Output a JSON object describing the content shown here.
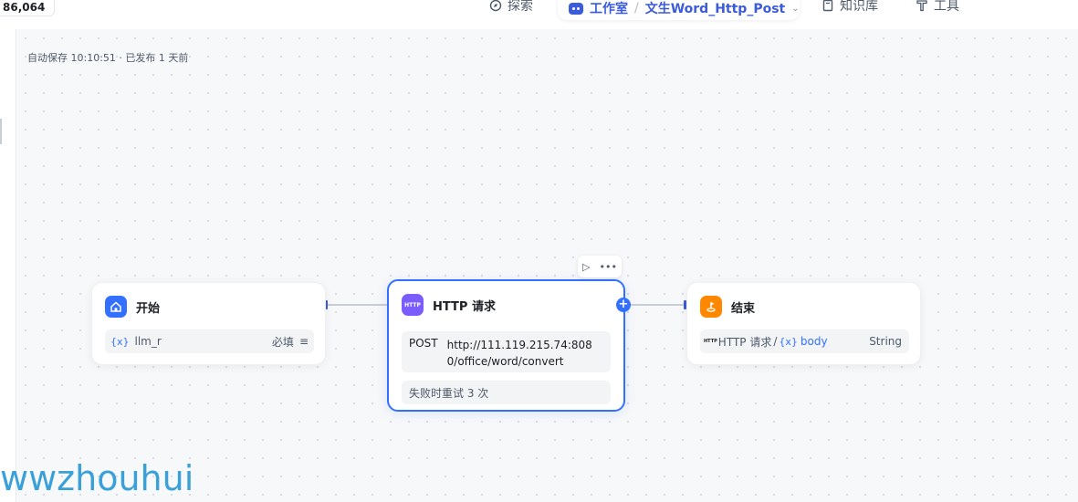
{
  "top_counter": "86,064",
  "nav": {
    "explore": "探索",
    "workspace": "工作室",
    "project": "文生Word_Http_Post",
    "knowledge": "知识库",
    "tools": "工具"
  },
  "status_line": "自动保存 10:10:51 · 已发布 1 天前",
  "nodes": {
    "start": {
      "title": "开始",
      "var_tag": "{x}",
      "var_name": "llm_r",
      "required_label": "必填"
    },
    "http": {
      "title": "HTTP 请求",
      "icon_label": "HTTP",
      "method": "POST",
      "url": "http://111.119.215.74:8080/office/word/convert",
      "retry": "失败时重试 3 次"
    },
    "end": {
      "title": "结束",
      "source_tag": "HTTP",
      "source_node": "HTTP 请求",
      "var_tag": "{x}",
      "var_name": "body",
      "type": "String"
    }
  },
  "watermark": "wwzhouhui",
  "colors": {
    "accent": "#3370ff",
    "start_icon": "#3370ff",
    "http_icon": "#7b5cff",
    "end_icon": "#ff8800"
  }
}
